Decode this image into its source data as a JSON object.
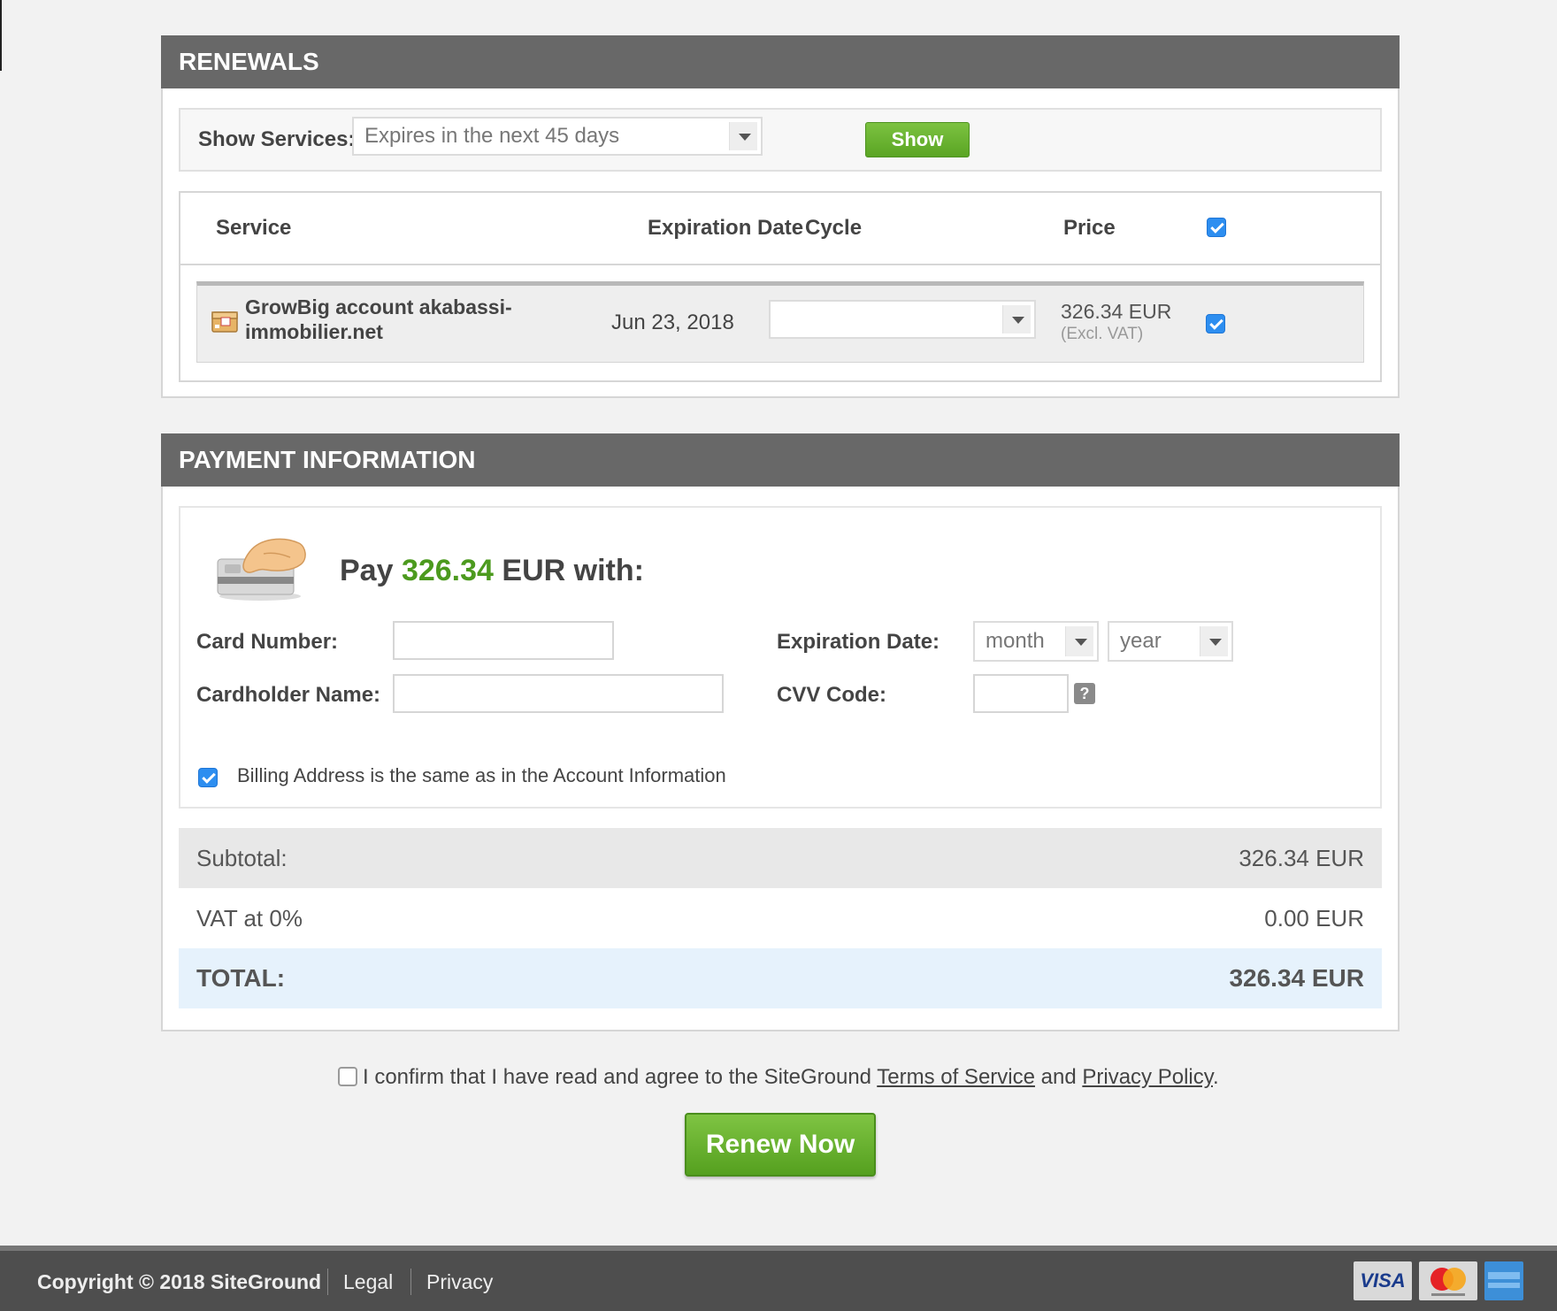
{
  "renewals": {
    "title": "RENEWALS",
    "show_label": "Show Services:",
    "filter_value": "Expires in the next 45 days",
    "show_button": "Show",
    "columns": {
      "service": "Service",
      "expiration": "Expiration Date",
      "cycle": "Cycle",
      "price": "Price"
    },
    "header_checkbox_checked": true,
    "rows": [
      {
        "name_line1": "GrowBig account akabassi-",
        "name_line2": "immobilier.net",
        "expiration": "Jun 23, 2018",
        "cycle": "",
        "price": "326.34 EUR",
        "price_note": "(Excl. VAT)",
        "checked": true,
        "icon": "package-icon"
      }
    ]
  },
  "payment": {
    "title": "PAYMENT INFORMATION",
    "pay_prefix": "Pay",
    "pay_amount": "326.34",
    "pay_suffix": "EUR with:",
    "card_number_label": "Card Number:",
    "cardholder_label": "Cardholder Name:",
    "expiration_label": "Expiration Date:",
    "month_value": "month",
    "year_value": "year",
    "cvv_label": "CVV Code:",
    "cvv_help": "?",
    "billing_same_label": "Billing Address is the same as in the Account Information",
    "billing_same_checked": true,
    "accent_color": "#4c9a1e"
  },
  "summary": {
    "subtotal_label": "Subtotal:",
    "subtotal_value": "326.34 EUR",
    "vat_label": "VAT at 0%",
    "vat_value": "0.00 EUR",
    "total_label": "TOTAL:",
    "total_value": "326.34 EUR"
  },
  "confirm": {
    "text_before": "I confirm that I have read and agree to the SiteGround",
    "terms_link": "Terms of Service",
    "and": "and",
    "privacy_link": "Privacy Policy",
    "period": ".",
    "checked": false
  },
  "renew_button": "Renew Now",
  "footer": {
    "copyright": "Copyright © 2018 SiteGround",
    "legal": "Legal",
    "privacy": "Privacy",
    "visa": "VISA",
    "card_logos": [
      "visa-logo",
      "mastercard-logo",
      "amex-logo"
    ]
  }
}
